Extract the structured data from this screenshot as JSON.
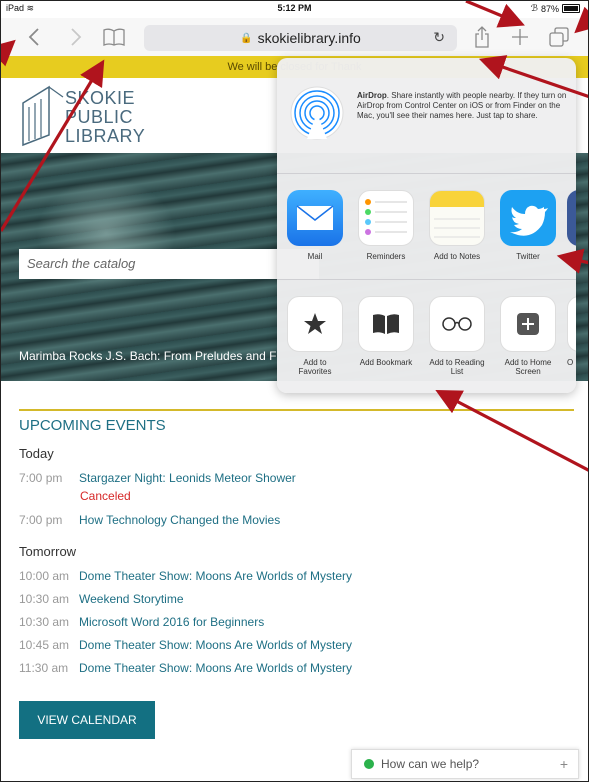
{
  "status": {
    "device": "iPad",
    "time": "5:12 PM",
    "battery": "87%",
    "battery_level": 0.87
  },
  "toolbar": {
    "url": "skokielibrary.info"
  },
  "banner": {
    "text": "We will be closed for Thank"
  },
  "logo": {
    "line1": "SKOKIE",
    "line2": "PUBLIC",
    "line3": "LIBRARY"
  },
  "hero": {
    "search_placeholder": "Search the catalog",
    "caption": "Marimba Rocks J.S. Bach: From Preludes and F"
  },
  "share": {
    "airdrop_title": "AirDrop",
    "airdrop_text": ". Share instantly with people nearby. If they turn on AirDrop from Control Center on iOS or from Finder on the Mac, you'll see their names here. Just tap to share.",
    "apps": [
      {
        "label": "Mail"
      },
      {
        "label": "Reminders"
      },
      {
        "label": "Add to Notes"
      },
      {
        "label": "Twitter"
      }
    ],
    "actions": [
      {
        "label": "Add to Favorites"
      },
      {
        "label": "Add Bookmark"
      },
      {
        "label": "Add to Reading List"
      },
      {
        "label": "Add to Home Screen"
      },
      {
        "label": "O"
      }
    ]
  },
  "events": {
    "title": "UPCOMING EVENTS",
    "today_label": "Today",
    "today": [
      {
        "time": "7:00 pm",
        "name": "Stargazer Night: Leonids Meteor Shower",
        "status": "Canceled"
      },
      {
        "time": "7:00 pm",
        "name": "How Technology Changed the Movies"
      }
    ],
    "tomorrow_label": "Tomorrow",
    "tomorrow": [
      {
        "time": "10:00 am",
        "name": "Dome Theater Show: Moons Are Worlds of Mystery"
      },
      {
        "time": "10:30 am",
        "name": "Weekend Storytime"
      },
      {
        "time": "10:30 am",
        "name": "Microsoft Word 2016 for Beginners"
      },
      {
        "time": "10:45 am",
        "name": "Dome Theater Show: Moons Are Worlds of Mystery"
      },
      {
        "time": "11:30 am",
        "name": "Dome Theater Show: Moons Are Worlds of Mystery"
      }
    ],
    "calendar_button": "VIEW CALENDAR"
  },
  "help": {
    "text": "How can we help?"
  }
}
